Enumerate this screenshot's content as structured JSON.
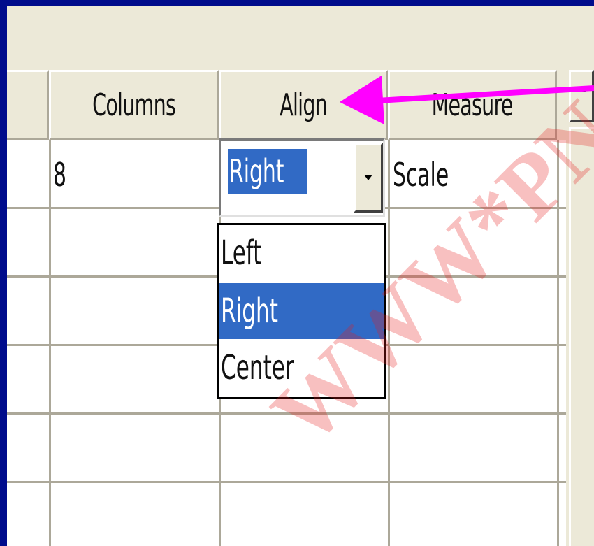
{
  "grid": {
    "headers": [
      "Columns",
      "Align",
      "Measure"
    ],
    "row1": {
      "columns": "8",
      "align": "Right",
      "measure": "Scale"
    }
  },
  "combo": {
    "value": "Right",
    "options": [
      "Left",
      "Right",
      "Center"
    ],
    "selected_index": 1
  },
  "watermark": "WWW*PN",
  "colors": {
    "frame": "#000c8c",
    "selection": "#316ac5",
    "arrow": "#ff00ff",
    "watermark": "#e61e1e"
  }
}
